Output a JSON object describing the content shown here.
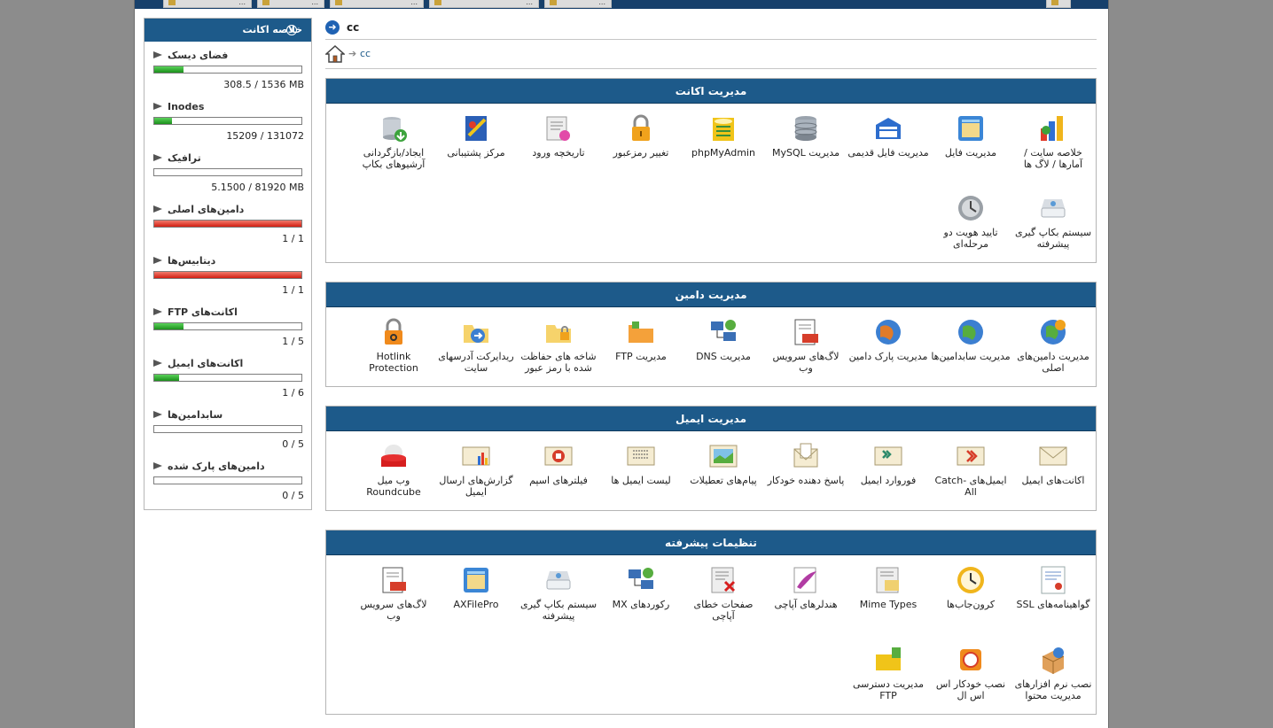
{
  "top_tabs": [
    {
      "label": "..."
    },
    {
      "label": "..."
    },
    {
      "label": "..."
    },
    {
      "label": "..."
    },
    {
      "label": "..."
    }
  ],
  "sidebar": {
    "title": "خلاصه اکانت",
    "stats": [
      {
        "label": "فضای دیسک",
        "value": "308.5 / 1536 MB",
        "fill": 0.2,
        "color": "#2eaa2e"
      },
      {
        "label": "Inodes",
        "value": "15209 / 131072",
        "fill": 0.12,
        "color": "#2eaa2e"
      },
      {
        "label": "ترافیک",
        "value": "5.1500 / 81920 MB",
        "fill": 0.0,
        "color": "#2eaa2e"
      },
      {
        "label": "دامین‌های اصلی",
        "value": "1 / 1",
        "fill": 1.0,
        "color": "#dd2a1e"
      },
      {
        "label": "دیتابیس‌ها",
        "value": "1 / 1",
        "fill": 1.0,
        "color": "#dd2a1e"
      },
      {
        "label": "اکانت‌های FTP",
        "value": "1 / 5",
        "fill": 0.2,
        "color": "#2eaa2e"
      },
      {
        "label": "اکانت‌های ایمیل",
        "value": "1 / 6",
        "fill": 0.17,
        "color": "#2eaa2e"
      },
      {
        "label": "سابدامین‌ها",
        "value": "0 / 5",
        "fill": 0.0,
        "color": "#2eaa2e"
      },
      {
        "label": "دامین‌های پارک شده",
        "value": "0 / 5",
        "fill": 0.0,
        "color": "#2eaa2e"
      }
    ]
  },
  "header": {
    "title": "cc",
    "breadcrumb": "cc"
  },
  "sections": [
    {
      "title": "مدیریت اکانت",
      "items": [
        {
          "label": "خلاصه سایت / آمارها / لاگ ها",
          "icon": "stats-icon"
        },
        {
          "label": "مدیریت فایل",
          "icon": "file-manager-icon"
        },
        {
          "label": "مدیریت فایل قدیمی",
          "icon": "legacy-file-manager-icon"
        },
        {
          "label": "مدیریت MySQL",
          "icon": "database-icon"
        },
        {
          "label": "phpMyAdmin",
          "icon": "phpmyadmin-icon"
        },
        {
          "label": "تغییر رمزعبور",
          "icon": "lock-icon"
        },
        {
          "label": "تاریخچه ورود",
          "icon": "login-history-icon"
        },
        {
          "label": "مرکز پشتیبانی",
          "icon": "support-icon"
        },
        {
          "label": "ایجاد/بازگردانی آرشیوهای بکاپ",
          "icon": "backup-archive-icon"
        },
        {
          "label": "سیستم بکاپ گیری پیشرفته",
          "icon": "backup-disk-icon"
        },
        {
          "label": "تایید هویت دو مرحله‌ای",
          "icon": "two-factor-icon"
        }
      ]
    },
    {
      "title": "مدیریت دامین",
      "items": [
        {
          "label": "مدیریت دامین‌های اصلی",
          "icon": "globe-gear-icon"
        },
        {
          "label": "مدیریت سابدامین‌ها",
          "icon": "globe-icon"
        },
        {
          "label": "مدیریت پارک دامین",
          "icon": "globe-park-icon"
        },
        {
          "label": "لاگ‌های سرویس وب",
          "icon": "log-icon"
        },
        {
          "label": "مدیریت DNS",
          "icon": "dns-icon"
        },
        {
          "label": "مدیریت FTP",
          "icon": "ftp-folder-icon"
        },
        {
          "label": "شاخه های حفاظت شده با رمز عبور",
          "icon": "protected-folder-icon"
        },
        {
          "label": "ریدایرکت آدرسهای سایت",
          "icon": "redirect-icon"
        },
        {
          "label": "Hotlink Protection",
          "icon": "hotlink-icon"
        }
      ]
    },
    {
      "title": "مدیریت ایمیل",
      "items": [
        {
          "label": "اکانت‌های ایمیل",
          "icon": "email-icon"
        },
        {
          "label": "ایمیل‌های Catch-All",
          "icon": "catch-all-icon"
        },
        {
          "label": "فوروارد ایمیل",
          "icon": "forward-icon"
        },
        {
          "label": "پاسخ دهنده خودکار",
          "icon": "autoresponder-icon"
        },
        {
          "label": "پیام‌های تعطیلات",
          "icon": "vacation-icon"
        },
        {
          "label": "لیست ایمیل ها",
          "icon": "mailing-list-icon"
        },
        {
          "label": "فیلترهای اسپم",
          "icon": "spam-filter-icon"
        },
        {
          "label": "گزارش‌های ارسال ایمیل",
          "icon": "email-report-icon"
        },
        {
          "label": "وب میل Roundcube",
          "icon": "roundcube-icon"
        }
      ]
    },
    {
      "title": "تنظیمات پیشرفته",
      "items": [
        {
          "label": "گواهینامه‌های SSL",
          "icon": "certificate-icon"
        },
        {
          "label": "کرون‌جاب‌ها",
          "icon": "clock-icon"
        },
        {
          "label": "Mime Types",
          "icon": "mime-icon"
        },
        {
          "label": "هندلرهای آپاچی",
          "icon": "apache-icon"
        },
        {
          "label": "صفحات خطای آپاچی",
          "icon": "error-pages-icon"
        },
        {
          "label": "رکوردهای MX",
          "icon": "mx-icon"
        },
        {
          "label": "سیستم بکاپ گیری پیشرفته",
          "icon": "backup-disk-icon"
        },
        {
          "label": "AXFilePro",
          "icon": "axfilepro-icon"
        },
        {
          "label": "لاگ‌های سرویس وب",
          "icon": "log-icon"
        },
        {
          "label": "نصب نرم افزارهای مدیریت محتوا",
          "icon": "installer-icon"
        },
        {
          "label": "نصب خودکار اس اس ال",
          "icon": "ssl-icon"
        },
        {
          "label": "مدیریت دسترسی FTP",
          "icon": "ftp-access-icon"
        }
      ]
    }
  ]
}
